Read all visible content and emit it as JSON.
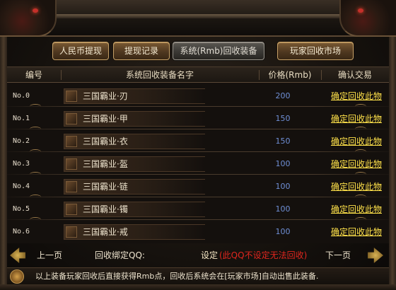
{
  "tabs": [
    {
      "label": "人民币提现",
      "active": false
    },
    {
      "label": "提现记录",
      "active": false
    },
    {
      "label": "系统(Rmb)回收装备",
      "active": true
    },
    {
      "label": "玩家回收市场",
      "active": false
    }
  ],
  "table": {
    "headers": {
      "num": "编号",
      "name": "系统回收装备名字",
      "price": "价格(Rmb)",
      "action": "确认交易"
    },
    "rows": [
      {
        "num": "No.0",
        "name": "三国霸业·刃",
        "price": "200",
        "action": "确定回收此物"
      },
      {
        "num": "No.1",
        "name": "三国霸业·甲",
        "price": "150",
        "action": "确定回收此物"
      },
      {
        "num": "No.2",
        "name": "三国霸业·衣",
        "price": "150",
        "action": "确定回收此物"
      },
      {
        "num": "No.3",
        "name": "三国霸业·盔",
        "price": "100",
        "action": "确定回收此物"
      },
      {
        "num": "No.4",
        "name": "三国霸业·链",
        "price": "100",
        "action": "确定回收此物"
      },
      {
        "num": "No.5",
        "name": "三国霸业·镯",
        "price": "100",
        "action": "确定回收此物"
      },
      {
        "num": "No.6",
        "name": "三国霸业·戒",
        "price": "100",
        "action": "确定回收此物"
      }
    ]
  },
  "footer": {
    "prev_label": "上一页",
    "next_label": "下一页",
    "qq_label": "回收绑定QQ:",
    "qq_set": "设定",
    "qq_warning": "(此QQ不设定无法回收)"
  },
  "notice": {
    "text": "以上装备玩家回收后直接获得Rmb点，回收后系统会在[玩家市场]自动出售此装备."
  },
  "colors": {
    "price": "#6f8fd6",
    "action_link": "#ffe24a",
    "warning": "#e0261e"
  }
}
